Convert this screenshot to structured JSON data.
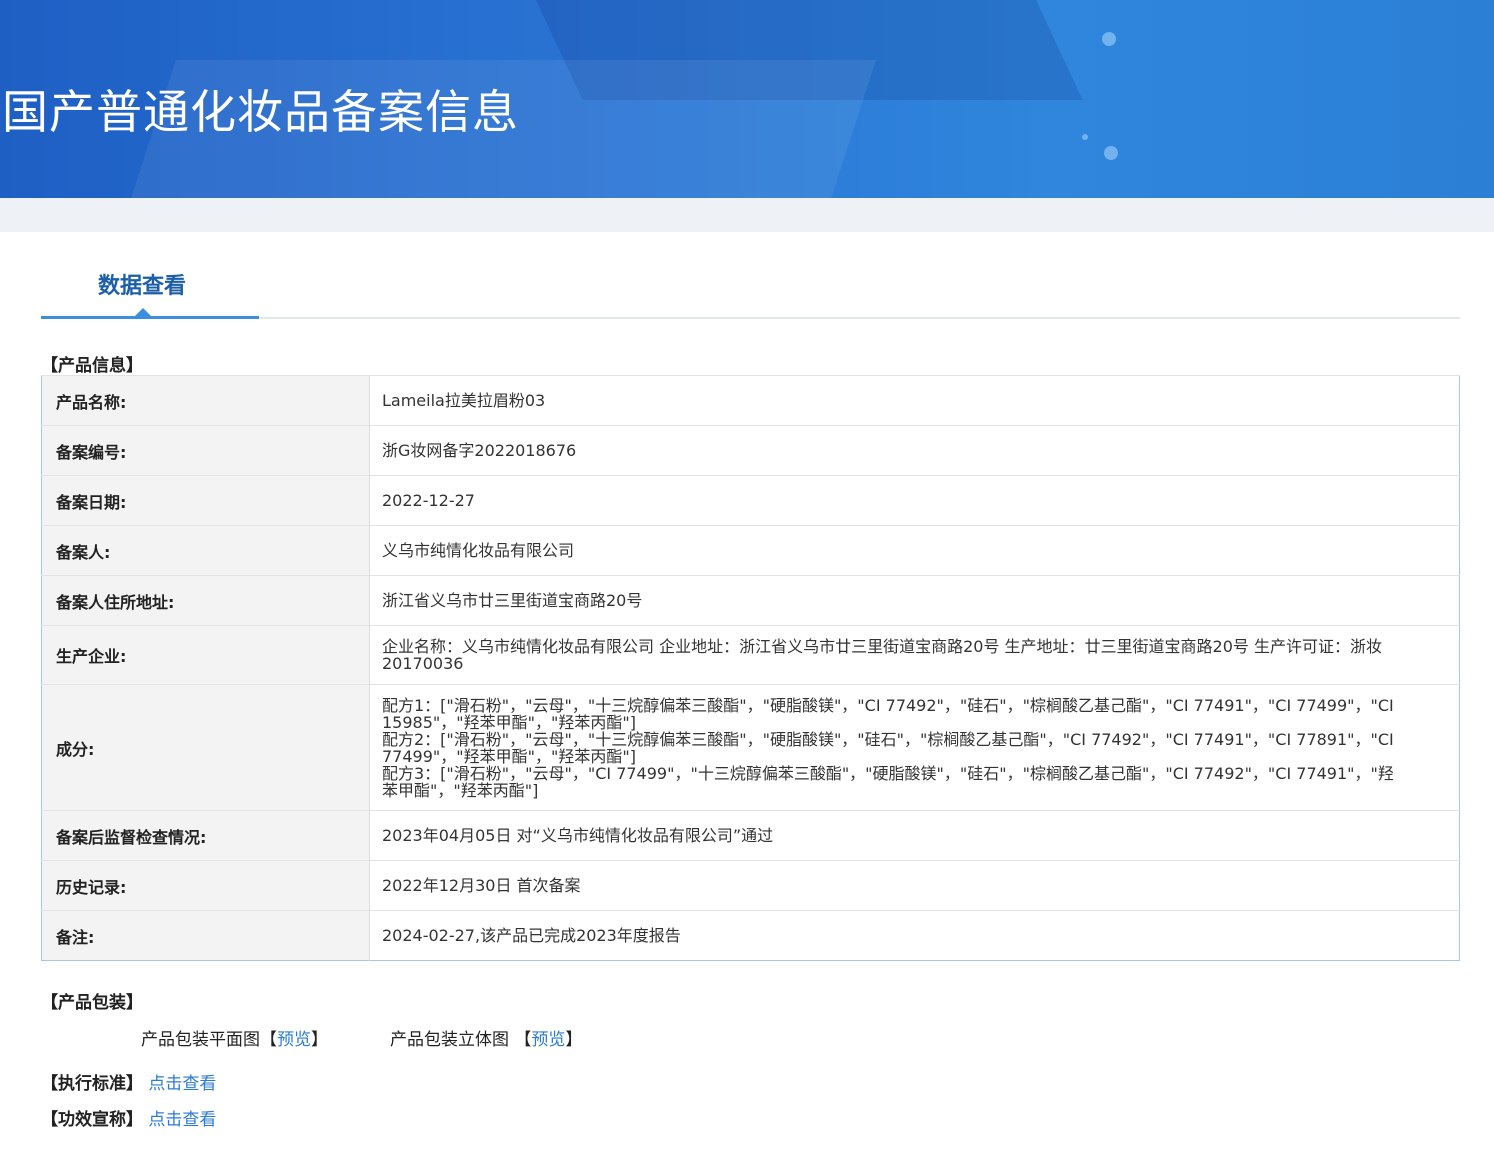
{
  "header": {
    "title": "国产普通化妆品备案信息"
  },
  "tab": {
    "label": "数据查看"
  },
  "product_info": {
    "section_title": "【产品信息】",
    "rows": [
      {
        "label": "产品名称:",
        "value": "Lameila拉美拉眉粉03"
      },
      {
        "label": "备案编号:",
        "value": "浙G妆网备字2022018676"
      },
      {
        "label": "备案日期:",
        "value": "2022-12-27"
      },
      {
        "label": "备案人:",
        "value": "义乌市纯情化妆品有限公司"
      },
      {
        "label": "备案人住所地址:",
        "value": "浙江省义乌市廿三里街道宝商路20号"
      },
      {
        "label": "生产企业:",
        "value": "企业名称：义乌市纯情化妆品有限公司 企业地址：浙江省义乌市廿三里街道宝商路20号 生产地址：廿三里街道宝商路20号 生产许可证：浙妆20170036"
      },
      {
        "label": "成分:",
        "lines": [
          "配方1：[\"滑石粉\"，\"云母\"，\"十三烷醇偏苯三酸酯\"，\"硬脂酸镁\"，\"CI 77492\"，\"硅石\"，\"棕榈酸乙基己酯\"，\"CI 77491\"，\"CI 77499\"，\"CI 15985\"，\"羟苯甲酯\"，\"羟苯丙酯\"]",
          "配方2：[\"滑石粉\"，\"云母\"，\"十三烷醇偏苯三酸酯\"，\"硬脂酸镁\"，\"硅石\"，\"棕榈酸乙基己酯\"，\"CI 77492\"，\"CI 77491\"，\"CI 77891\"，\"CI 77499\"，\"羟苯甲酯\"，\"羟苯丙酯\"]",
          "配方3：[\"滑石粉\"，\"云母\"，\"CI 77499\"，\"十三烷醇偏苯三酸酯\"，\"硬脂酸镁\"，\"硅石\"，\"棕榈酸乙基己酯\"，\"CI 77492\"，\"CI 77491\"，\"羟苯甲酯\"，\"羟苯丙酯\"]"
        ]
      },
      {
        "label": "备案后监督检查情况:",
        "value": "2023年04月05日 对“义乌市纯情化妆品有限公司”通过"
      },
      {
        "label": "历史记录:",
        "value": "2022年12月30日 首次备案"
      },
      {
        "label": "备注:",
        "value": "2024-02-27,该产品已完成2023年度报告"
      }
    ]
  },
  "packaging": {
    "section_title": "【产品包装】",
    "flat_label": "产品包装平面图【",
    "flat_link": "预览",
    "flat_close": "】",
    "solid_label": "产品包装立体图 【",
    "solid_link": "预览",
    "solid_close": "】"
  },
  "standard": {
    "label": "【执行标准】",
    "link": "点击查看"
  },
  "efficacy": {
    "label": "【功效宣称】",
    "link": "点击查看"
  },
  "colors": {
    "banner": "#2a74d4",
    "accent": "#3b8fdc",
    "link": "#2c7bd8",
    "tab_text": "#1c5fa8"
  }
}
